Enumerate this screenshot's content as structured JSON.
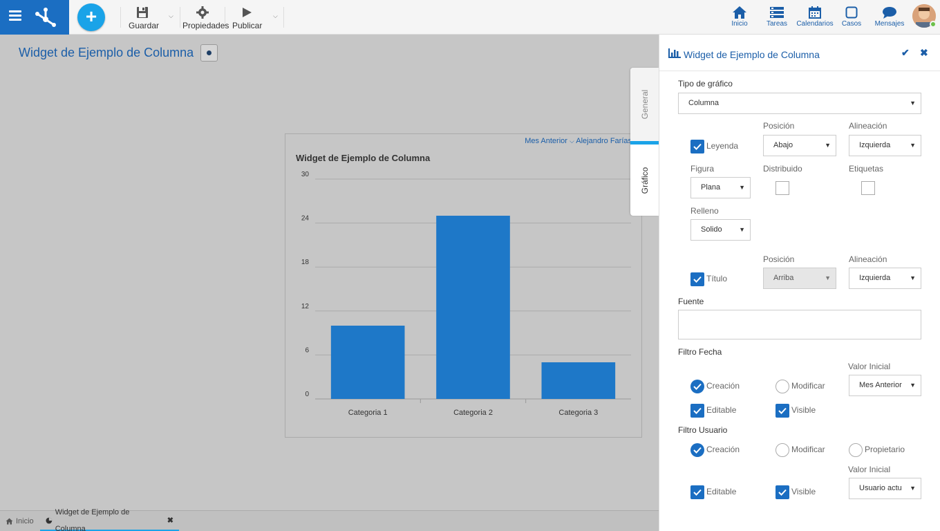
{
  "toolbar": {
    "save_label": "Guardar",
    "properties_label": "Propiedades",
    "publish_label": "Publicar"
  },
  "nav": {
    "home": "Inicio",
    "tasks": "Tareas",
    "calendars": "Calendarios",
    "cases": "Casos",
    "messages": "Mensajes"
  },
  "page": {
    "title": "Widget de Ejemplo de Columna"
  },
  "widget": {
    "filter_date": "Mes Anterior",
    "filter_user": "Alejandro Farías",
    "title": "Widget de Ejemplo de Columna"
  },
  "chart_data": {
    "type": "bar",
    "title": "Widget de Ejemplo de Columna",
    "categories": [
      "Categoria 1",
      "Categoria 2",
      "Categoria 3"
    ],
    "values": [
      10,
      25,
      5
    ],
    "yticks": [
      0,
      6,
      12,
      18,
      24,
      30
    ],
    "ylim": [
      0,
      30
    ],
    "grid": true,
    "color": "#1e78c8"
  },
  "bottom_tabs": {
    "home": "Inicio",
    "current": "Widget de Ejemplo de Columna"
  },
  "vtabs": {
    "general": "General",
    "chart": "Gráfico"
  },
  "panel": {
    "title": "Widget de Ejemplo de Columna",
    "chart_type_label": "Tipo de gráfico",
    "chart_type_value": "Columna",
    "legend_label": "Leyenda",
    "position_label": "Posición",
    "alignment_label": "Alineación",
    "legend_position": "Abajo",
    "legend_alignment": "Izquierda",
    "figure_label": "Figura",
    "figure_value": "Plana",
    "distributed_label": "Distribuido",
    "labels_label": "Etiquetas",
    "fill_label": "Relleno",
    "fill_value": "Solido",
    "title_label": "Título",
    "title_position_label": "Posición",
    "title_alignment_label": "Alineación",
    "title_position": "Arriba",
    "title_alignment": "Izquierda",
    "source_label": "Fuente",
    "date_filter_label": "Filtro Fecha",
    "date_initial_label": "Valor Inicial",
    "date_initial_value": "Mes Anterior",
    "creation_label": "Creación",
    "modify_label": "Modificar",
    "editable_label": "Editable",
    "visible_label": "Visible",
    "user_filter_label": "Filtro Usuario",
    "user_creation_label": "Creación",
    "user_modify_label": "Modificar",
    "owner_label": "Propietario",
    "user_initial_label": "Valor Inicial",
    "user_initial_value": "Usuario actu",
    "user_editable_label": "Editable",
    "user_visible_label": "Visible"
  }
}
